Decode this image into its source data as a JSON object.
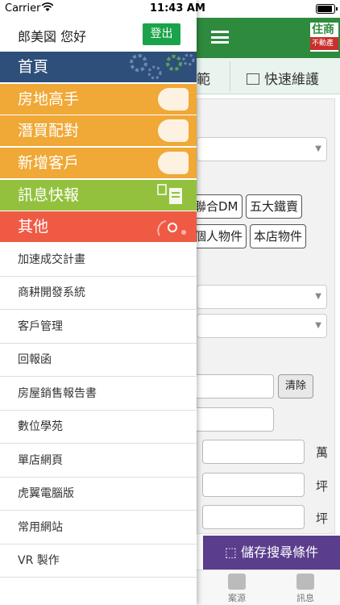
{
  "status": {
    "carrier": "Carrier",
    "time": "11:43 AM"
  },
  "background": {
    "brand_top": "住商",
    "brand_bottom": "不動產",
    "tab_left_partial": "範",
    "tab_right": "快速維護",
    "chips": [
      "聯合DM",
      "五大鐵賣",
      "個人物件",
      "本店物件"
    ],
    "clear_label": "清除",
    "units": [
      "萬",
      "坪",
      "坪"
    ],
    "save_label": "儲存搜尋條件",
    "tabbar": [
      "案源",
      "訊息"
    ]
  },
  "drawer": {
    "greeting": "郎美図 您好",
    "logout_label": "登出",
    "categories": [
      {
        "label": "首頁",
        "color": "#2e4f7a"
      },
      {
        "label": "房地高手",
        "color": "#f0a836"
      },
      {
        "label": "潛買配對",
        "color": "#f0a836"
      },
      {
        "label": "新增客戶",
        "color": "#f0a836"
      },
      {
        "label": "訊息快報",
        "color": "#93c13e"
      },
      {
        "label": "其他",
        "color": "#ef5a44"
      }
    ],
    "sub_items": [
      "加速成交計畫",
      "商耕開發系統",
      "客戶管理",
      "回報函",
      "房屋銷售報告書",
      "數位學苑",
      "單店網頁",
      "虎翼電腦版",
      "常用網站",
      "VR 製作"
    ]
  }
}
